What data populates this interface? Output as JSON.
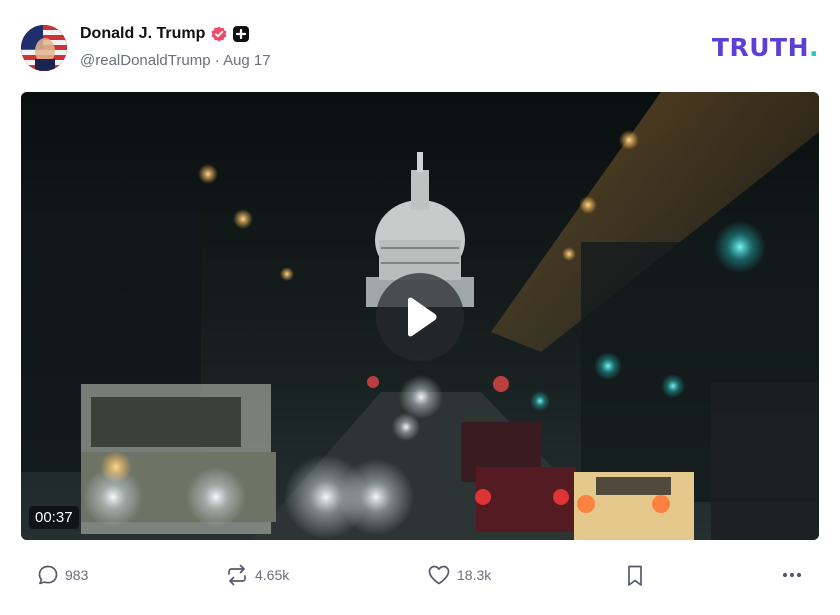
{
  "post": {
    "author_name": "Donald J. Trump",
    "handle": "@realDonaldTrump",
    "separator": "·",
    "date": "Aug 17"
  },
  "brand": {
    "text": "TRUTH",
    "dot": ".",
    "color": "#5b3fd6",
    "dot_color": "#27c7c2"
  },
  "video": {
    "duration": "00:37"
  },
  "actions": {
    "replies": "983",
    "retruths": "4.65k",
    "likes": "18.3k"
  },
  "icons": {
    "verified": "verified-badge-icon",
    "plus": "plus-badge-icon",
    "play": "play-icon",
    "reply": "comment-bubble-icon",
    "retruth": "repost-arrows-icon",
    "like": "heart-icon",
    "bookmark": "bookmark-icon",
    "more": "more-dots-icon"
  }
}
